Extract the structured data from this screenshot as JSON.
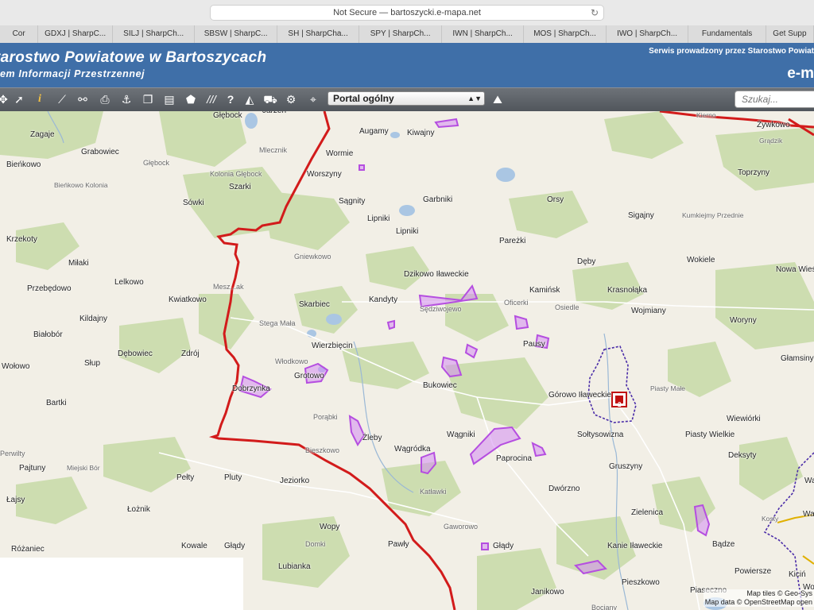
{
  "browser": {
    "url_text": "Not Secure — bartoszycki.e-mapa.net",
    "tabs": [
      "Cor",
      "GDXJ | SharpC...",
      "SILJ | SharpCh...",
      "SBSW | SharpC...",
      "SH | SharpCha...",
      "SPY | SharpCh...",
      "IWN | SharpCh...",
      "MOS | SharpCh...",
      "IWO | SharpCh...",
      "Fundamentals",
      "Get Supp"
    ]
  },
  "header": {
    "title": "tarostwo Powiatowe w Bartoszycach",
    "subtitle": "em Informacji Przestrzennej",
    "service_note": "Serwis prowadzony przez Starostwo Powiat",
    "brand": "e-m"
  },
  "toolbar": {
    "portal_selected": "Portal ogólny",
    "search_placeholder": "Szukaj...",
    "icons": [
      "pointer-icon",
      "info-icon",
      "measure-icon",
      "print-icon",
      "anchor-icon",
      "copy-icon",
      "layout-icon",
      "shape-icon",
      "hatch-icon",
      "help-icon",
      "compass-icon",
      "cart-icon",
      "settings-icon",
      "location-pin-icon",
      "terrain-icon"
    ]
  },
  "map": {
    "places": [
      {
        "name": "Głębock",
        "cls": ""
      },
      {
        "name": "Jarzeń",
        "cls": ""
      },
      {
        "name": "Augamy",
        "cls": ""
      },
      {
        "name": "Kiwajny",
        "cls": ""
      },
      {
        "name": "Kierno",
        "cls": "tiny"
      },
      {
        "name": "Żywkowo",
        "cls": ""
      },
      {
        "name": "Grądzik",
        "cls": "tiny"
      },
      {
        "name": "Zagaje",
        "cls": ""
      },
      {
        "name": "Grabowiec",
        "cls": ""
      },
      {
        "name": "Mlecznik",
        "cls": "minor"
      },
      {
        "name": "Wormie",
        "cls": ""
      },
      {
        "name": "Bieńkowo",
        "cls": ""
      },
      {
        "name": "Głębock",
        "cls": "minor"
      },
      {
        "name": "Kolonia Głębock",
        "cls": "minor"
      },
      {
        "name": "Worszyny",
        "cls": ""
      },
      {
        "name": "Toprzyny",
        "cls": ""
      },
      {
        "name": "Bieńkowo Kolonia",
        "cls": "tiny"
      },
      {
        "name": "Szarki",
        "cls": ""
      },
      {
        "name": "Sówki",
        "cls": ""
      },
      {
        "name": "Sągnity",
        "cls": ""
      },
      {
        "name": "Garbniki",
        "cls": ""
      },
      {
        "name": "Orsy",
        "cls": ""
      },
      {
        "name": "Sigajny",
        "cls": ""
      },
      {
        "name": "Kumkiejmy Przednie",
        "cls": "tiny"
      },
      {
        "name": "Lipniki",
        "cls": ""
      },
      {
        "name": "Lipniki",
        "cls": ""
      },
      {
        "name": "Krzekoty",
        "cls": ""
      },
      {
        "name": "Pareżki",
        "cls": ""
      },
      {
        "name": "Gniewkowo",
        "cls": "minor"
      },
      {
        "name": "Miłaki",
        "cls": ""
      },
      {
        "name": "Dęby",
        "cls": ""
      },
      {
        "name": "Wokiele",
        "cls": ""
      },
      {
        "name": "Nowa Wieś Iławecka",
        "cls": ""
      },
      {
        "name": "Dzikowo Iławeckie",
        "cls": ""
      },
      {
        "name": "Lelkowo",
        "cls": ""
      },
      {
        "name": "Mesz...ak",
        "cls": "minor"
      },
      {
        "name": "Kamińsk",
        "cls": ""
      },
      {
        "name": "Krasnołąka",
        "cls": ""
      },
      {
        "name": "Przebędowo",
        "cls": ""
      },
      {
        "name": "Kwiatkowo",
        "cls": ""
      },
      {
        "name": "Kandyty",
        "cls": ""
      },
      {
        "name": "Sędziwojewo",
        "cls": "minor"
      },
      {
        "name": "Oficerki",
        "cls": "minor"
      },
      {
        "name": "Osiedle",
        "cls": "minor"
      },
      {
        "name": "Skarbiec",
        "cls": ""
      },
      {
        "name": "Wojmiany",
        "cls": ""
      },
      {
        "name": "Kildajny",
        "cls": ""
      },
      {
        "name": "Białobór",
        "cls": ""
      },
      {
        "name": "Stega Mała",
        "cls": "minor"
      },
      {
        "name": "Woryny",
        "cls": ""
      },
      {
        "name": "Pausy",
        "cls": ""
      },
      {
        "name": "Wierzbięcin",
        "cls": ""
      },
      {
        "name": "Dębowiec",
        "cls": ""
      },
      {
        "name": "Zdrój",
        "cls": ""
      },
      {
        "name": "Głamsiny",
        "cls": ""
      },
      {
        "name": "Włodkowo",
        "cls": "minor"
      },
      {
        "name": "Słup",
        "cls": ""
      },
      {
        "name": "Wołowo",
        "cls": ""
      },
      {
        "name": "Grotowo",
        "cls": ""
      },
      {
        "name": "Bukowiec",
        "cls": ""
      },
      {
        "name": "Piasty Małe",
        "cls": "tiny"
      },
      {
        "name": "Dobrzynka",
        "cls": ""
      },
      {
        "name": "Górowo Iławeckie",
        "cls": ""
      },
      {
        "name": "Bartki",
        "cls": ""
      },
      {
        "name": "Wiewiórki",
        "cls": ""
      },
      {
        "name": "Porąbki",
        "cls": "minor"
      },
      {
        "name": "Sołtysowizna",
        "cls": ""
      },
      {
        "name": "Żleby",
        "cls": ""
      },
      {
        "name": "Wągniki",
        "cls": ""
      },
      {
        "name": "Piasty Wielkie",
        "cls": ""
      },
      {
        "name": "Wągródka",
        "cls": ""
      },
      {
        "name": "Paprocina",
        "cls": ""
      },
      {
        "name": "Deksyty",
        "cls": ""
      },
      {
        "name": "Perwilty",
        "cls": "minor"
      },
      {
        "name": "Bieszkowo",
        "cls": "minor"
      },
      {
        "name": "Pajtuny",
        "cls": ""
      },
      {
        "name": "Miejski Bór",
        "cls": "tiny"
      },
      {
        "name": "Gruszyny",
        "cls": ""
      },
      {
        "name": "Pełty",
        "cls": ""
      },
      {
        "name": "Pluty",
        "cls": ""
      },
      {
        "name": "Jeziorko",
        "cls": ""
      },
      {
        "name": "Łajsy",
        "cls": ""
      },
      {
        "name": "Katławki",
        "cls": "minor"
      },
      {
        "name": "Dwórzno",
        "cls": ""
      },
      {
        "name": "Łożnik",
        "cls": ""
      },
      {
        "name": "Zielenica",
        "cls": ""
      },
      {
        "name": "Wopy",
        "cls": ""
      },
      {
        "name": "Gaworowo",
        "cls": "minor"
      },
      {
        "name": "Kowale",
        "cls": ""
      },
      {
        "name": "Głądy",
        "cls": ""
      },
      {
        "name": "Pawły",
        "cls": ""
      },
      {
        "name": "Głądy",
        "cls": ""
      },
      {
        "name": "Kanie Iławeckie",
        "cls": ""
      },
      {
        "name": "Bądze",
        "cls": ""
      },
      {
        "name": "Różaniec",
        "cls": ""
      },
      {
        "name": "Domki",
        "cls": "minor"
      },
      {
        "name": "Lubianka",
        "cls": ""
      },
      {
        "name": "Powiersze",
        "cls": ""
      },
      {
        "name": "Kiciń",
        "cls": ""
      },
      {
        "name": "Pieszkowo",
        "cls": ""
      },
      {
        "name": "Janikowo",
        "cls": ""
      },
      {
        "name": "Piaseczno",
        "cls": ""
      },
      {
        "name": "Kosty",
        "cls": "tiny"
      },
      {
        "name": "Wa",
        "cls": ""
      },
      {
        "name": "Wal",
        "cls": ""
      },
      {
        "name": "Wojci",
        "cls": ""
      },
      {
        "name": "Bociany",
        "cls": "minor"
      }
    ],
    "marker_label": "2",
    "attribution_line1": "Map tiles © Geo-Sys",
    "attribution_line2": "Map data © OpenStreetMap open"
  },
  "colors": {
    "banner": "#3f6fa8",
    "border": "#d21b1b",
    "parcel": "#b54ee0",
    "forest": "#cdddb0",
    "water": "#aac6e3"
  }
}
